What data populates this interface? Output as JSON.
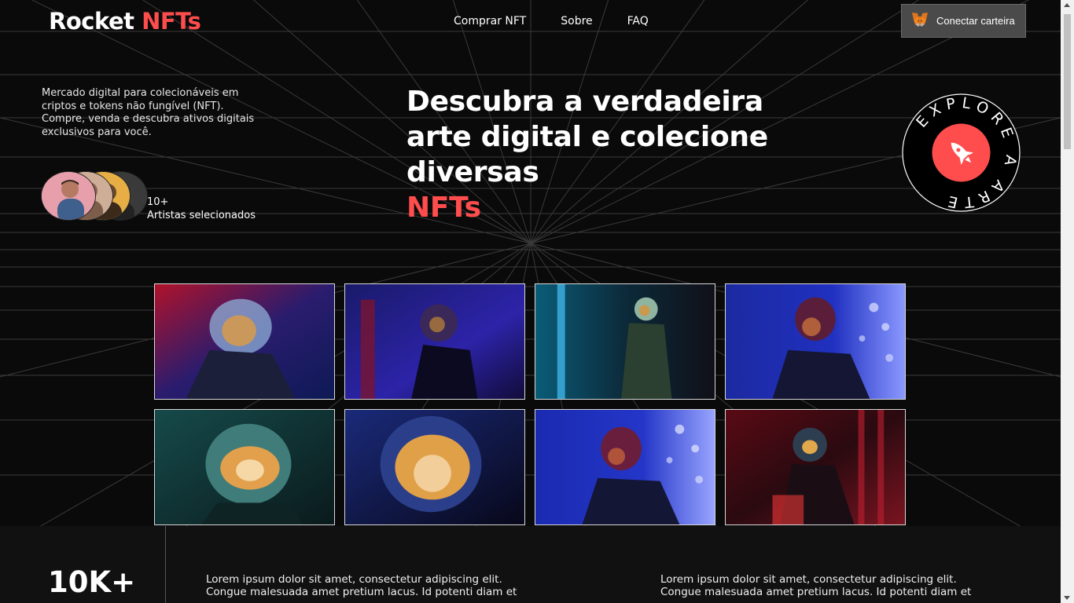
{
  "header": {
    "brand_main": "Rocket ",
    "brand_accent": "NFTs",
    "nav": [
      "Comprar NFT",
      "Sobre",
      "FAQ"
    ],
    "wallet_button": "Conectar carteira",
    "wallet_icon": "metamask-fox-icon"
  },
  "intro": {
    "description": "Mercado digital para colecionáveis em criptos e tokens não fungível (NFT). Compre, venda e descubra ativos digitais exclusivos para você.",
    "artists_count": "10+",
    "artists_label": "Artistas selecionados"
  },
  "hero": {
    "headline": "Descubra a verdadeira arte digital e colecione diversas",
    "headline_accent": "NFTs",
    "badge_text": "EXPLORE A ARTE",
    "badge_icon": "rocket-icon"
  },
  "gallery": {
    "tiles": [
      {
        "subject": "astronaut-red-blue"
      },
      {
        "subject": "astronaut-blue-dark"
      },
      {
        "subject": "astronaut-teal-green"
      },
      {
        "subject": "astronaut-blue-bright"
      },
      {
        "subject": "astronaut-teal-gold"
      },
      {
        "subject": "astronaut-gold-visor"
      },
      {
        "subject": "astronaut-blue-profile"
      },
      {
        "subject": "astronaut-red-sitting"
      }
    ]
  },
  "stats": {
    "number": "10K+",
    "text_1": "Lorem ipsum dolor sit amet, consectetur adipiscing elit. Congue malesuada amet pretium lacus. Id potenti diam et",
    "text_2": "Lorem ipsum dolor sit amet, consectetur adipiscing elit. Congue malesuada amet pretium lacus. Id potenti diam et"
  },
  "colors": {
    "accent": "#ff4d4d",
    "background": "#0a0a0b",
    "wallet_bg": "#4a4a4a"
  }
}
